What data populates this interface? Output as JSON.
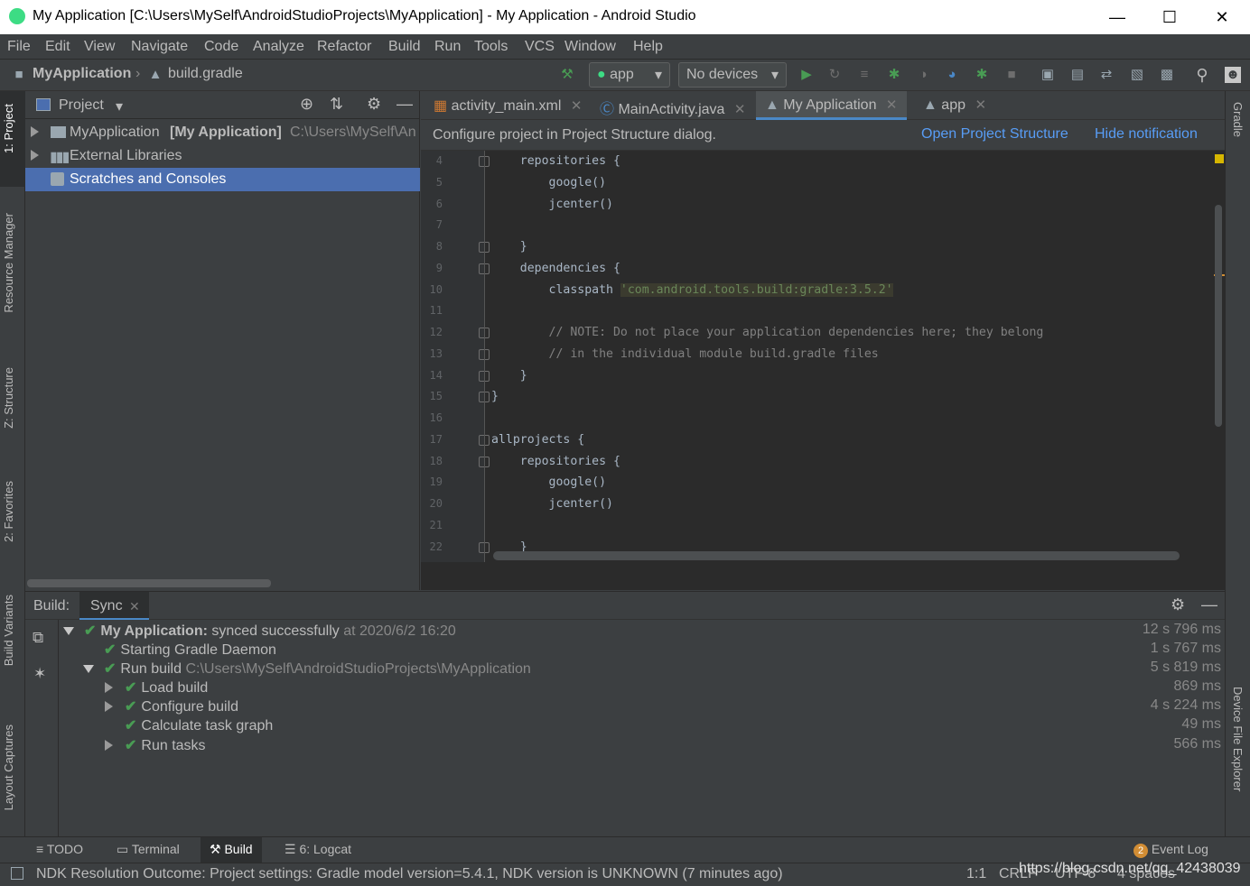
{
  "window": {
    "title": "My Application [C:\\Users\\MySelf\\AndroidStudioProjects\\MyApplication] - My Application - Android Studio"
  },
  "menu": [
    "File",
    "Edit",
    "View",
    "Navigate",
    "Code",
    "Analyze",
    "Refactor",
    "Build",
    "Run",
    "Tools",
    "VCS",
    "Window",
    "Help"
  ],
  "breadcrumb": {
    "project": "MyApplication",
    "file": "build.gradle"
  },
  "run_config": {
    "module": "app",
    "device": "No devices"
  },
  "left_strip": {
    "project": "1: Project",
    "resource_manager": "Resource Manager",
    "structure": "Z: Structure",
    "favorites": "2: Favorites",
    "build_variants": "Build Variants",
    "layout_captures": "Layout Captures"
  },
  "right_strip": {
    "gradle": "Gradle",
    "device_file_explorer": "Device File Explorer"
  },
  "project_panel": {
    "view_selector": "Project",
    "tree": [
      {
        "name": "MyApplication",
        "bold": "[My Application]",
        "path": "C:\\Users\\MySelf\\An"
      },
      {
        "name": "External Libraries"
      },
      {
        "name": "Scratches and Consoles"
      }
    ]
  },
  "editor": {
    "tabs": [
      "activity_main.xml",
      "MainActivity.java",
      "My Application",
      "app"
    ],
    "notification": {
      "text": "Configure project in Project Structure dialog.",
      "link1": "Open Project Structure",
      "link2": "Hide notification"
    },
    "lines": [
      {
        "n": "4",
        "text": "    repositories {"
      },
      {
        "n": "5",
        "text": "        google()"
      },
      {
        "n": "6",
        "text": "        jcenter()"
      },
      {
        "n": "7",
        "text": ""
      },
      {
        "n": "8",
        "text": "    }"
      },
      {
        "n": "9",
        "text": "    dependencies {"
      },
      {
        "n": "10",
        "text": "        classpath ",
        "string": "'com.android.tools.build:gradle:3.5.2'"
      },
      {
        "n": "11",
        "text": ""
      },
      {
        "n": "12",
        "comment": "        // NOTE: Do not place your application dependencies here; they belong"
      },
      {
        "n": "13",
        "comment": "        // in the individual module build.gradle files"
      },
      {
        "n": "14",
        "text": "    }"
      },
      {
        "n": "15",
        "text": "}"
      },
      {
        "n": "16",
        "text": ""
      },
      {
        "n": "17",
        "text": "allprojects {"
      },
      {
        "n": "18",
        "text": "    repositories {"
      },
      {
        "n": "19",
        "text": "        google()"
      },
      {
        "n": "20",
        "text": "        jcenter()"
      },
      {
        "n": "21",
        "text": ""
      },
      {
        "n": "22",
        "text": "    }"
      }
    ]
  },
  "build_panel": {
    "label": "Build:",
    "tab": "Sync",
    "rows": [
      {
        "title": "My Application:",
        "text": " synced successfully",
        "extra": " at 2020/6/2 16:20",
        "time": "12 s 796 ms"
      },
      {
        "text": "Starting Gradle Daemon",
        "time": "1 s 767 ms"
      },
      {
        "text": "Run build ",
        "extra": "C:\\Users\\MySelf\\AndroidStudioProjects\\MyApplication",
        "time": "5 s 819 ms"
      },
      {
        "text": "Load build",
        "time": "869 ms"
      },
      {
        "text": "Configure build",
        "time": "4 s 224 ms"
      },
      {
        "text": "Calculate task graph",
        "time": "49 ms"
      },
      {
        "text": "Run tasks",
        "time": "566 ms"
      }
    ]
  },
  "bottom_tabs": {
    "todo": "TODO",
    "terminal": "Terminal",
    "build": "Build",
    "logcat": "6: Logcat",
    "event_log": "Event Log",
    "event_count": "2"
  },
  "status": {
    "message": "NDK Resolution Outcome: Project settings: Gradle model version=5.4.1, NDK version is UNKNOWN (7 minutes ago)",
    "position": "1:1",
    "line_sep": "CRLF",
    "encoding": "UTF-8",
    "indent": "4 spaces",
    "watermark": "https://blog.csdn.net/qq_42438039"
  }
}
